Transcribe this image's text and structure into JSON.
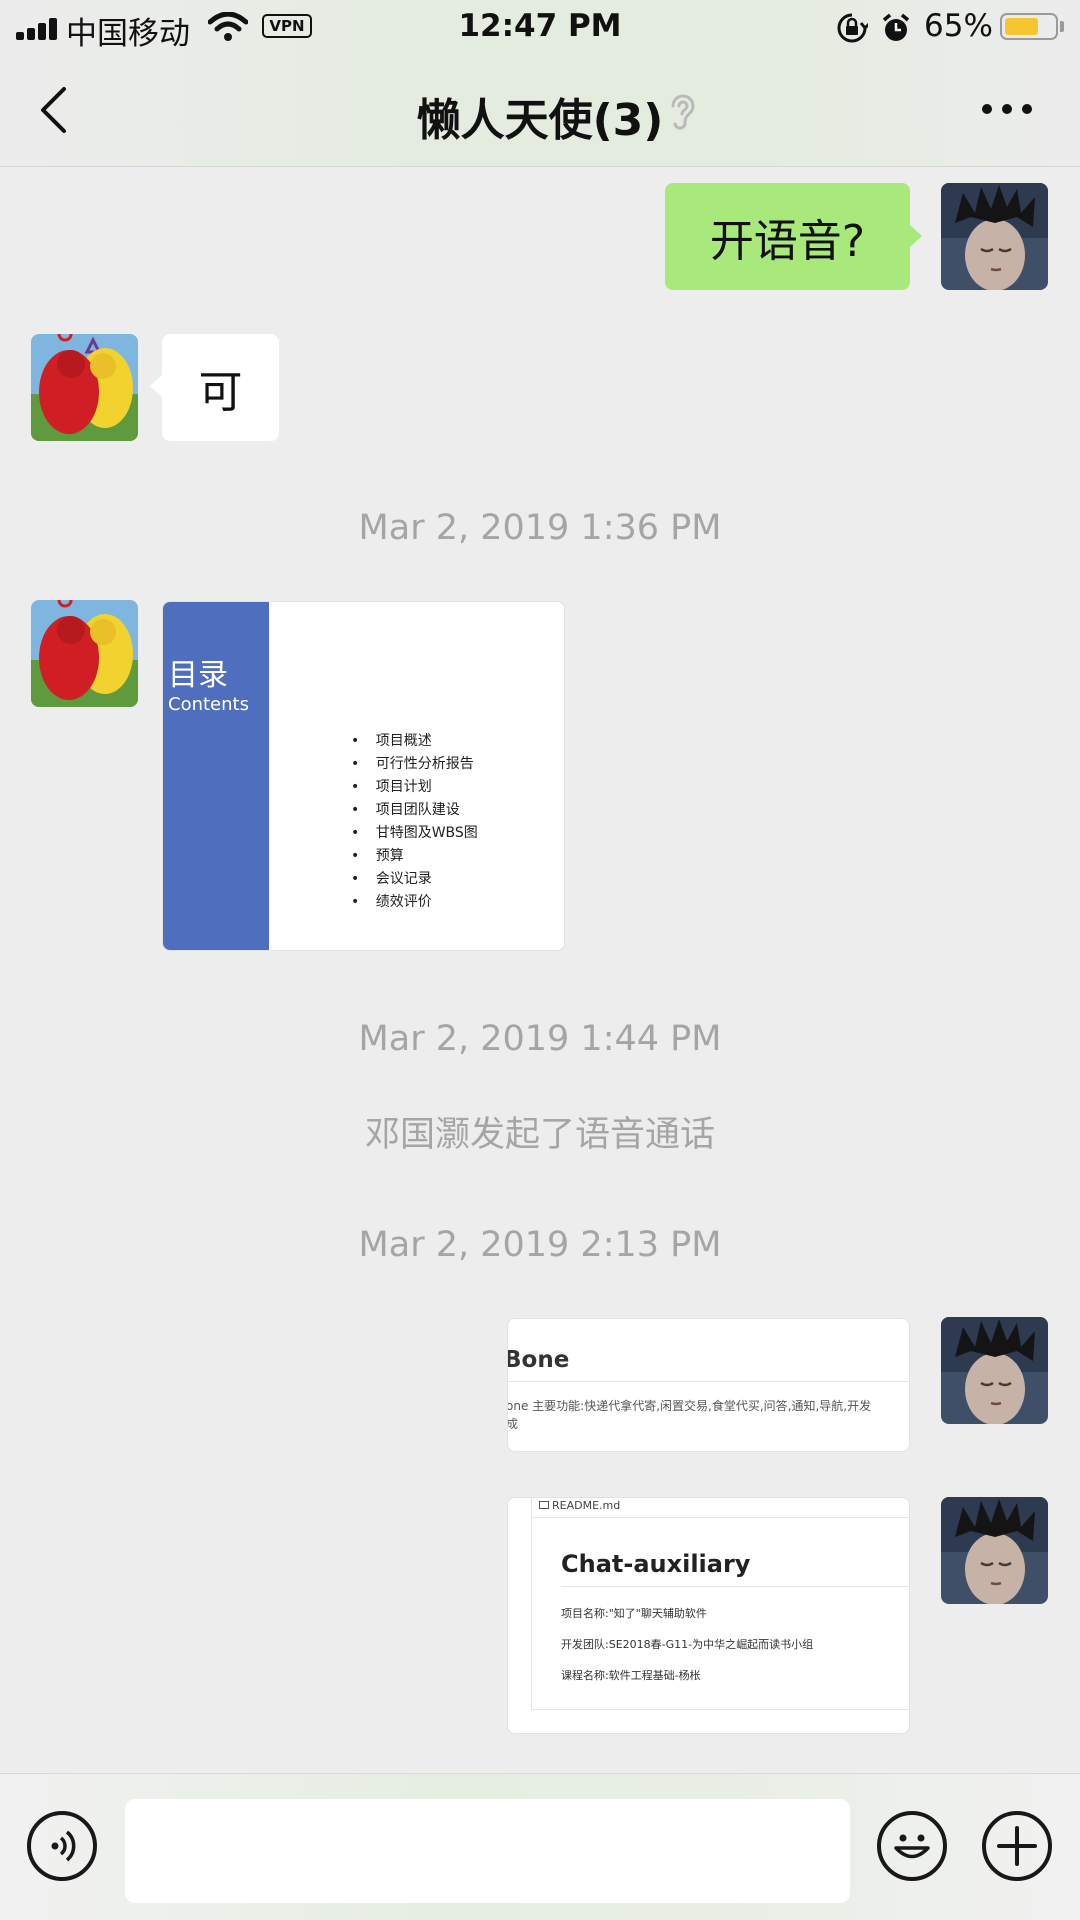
{
  "status_bar": {
    "carrier": "中国移动",
    "vpn": "VPN",
    "time": "12:47 PM",
    "battery_text": "65%",
    "battery_level": 0.65
  },
  "header": {
    "title": "懒人天使(3)",
    "icons": {
      "back": "chevron-left-icon",
      "mute": "ear-icon",
      "more": "more-dots-icon"
    }
  },
  "messages": {
    "m1": {
      "text": "开语音?"
    },
    "m2": {
      "text": "可"
    },
    "time1": "Mar 2, 2019 1:36 PM",
    "ppt": {
      "side_title": "目录",
      "side_subtitle": "Contents",
      "items": [
        "项目概述",
        "可行性分析报告",
        "项目计划",
        "项目团队建设",
        "甘特图及WBS图",
        "预算",
        "会议记录",
        "绩效评价"
      ]
    },
    "time2": "Mar 2, 2019 1:44 PM",
    "system": "邓国灏发起了语音通话",
    "time3": "Mar 2, 2019 2:13 PM",
    "card1": {
      "heading": "Bone",
      "line": "one 主要功能:快递代拿代寄,闲置交易,食堂代买,问答,通知,导航,开发",
      "line2": "成"
    },
    "card2": {
      "file": "README.md",
      "heading": "Chat-auxiliary",
      "rows": [
        "项目名称:\"知了\"聊天辅助软件",
        "开发团队:SE2018春-G11-为中华之崛起而读书小组",
        "课程名称:软件工程基础-杨枨"
      ]
    }
  },
  "input_bar": {
    "placeholder": "",
    "icons": {
      "voice": "voice-icon",
      "emoji": "emoji-icon",
      "plus": "plus-icon"
    }
  },
  "colors": {
    "background": "#ededed",
    "sent_bubble": "#a9e87a",
    "received_bubble": "#ffffff",
    "timestamp": "#a5a5a5",
    "slide_blue": "#4f6fbe"
  }
}
